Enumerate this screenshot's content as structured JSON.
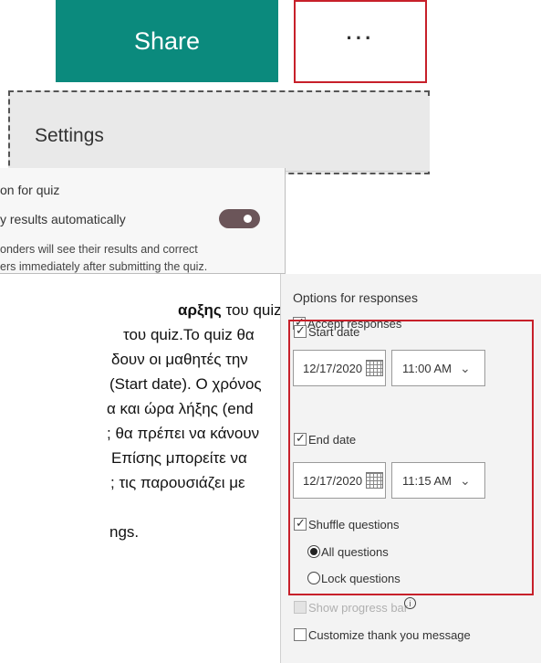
{
  "toolbar": {
    "share_label": "Share",
    "more_label": "···"
  },
  "settings": {
    "label": "Settings"
  },
  "quiz_options": {
    "title": "on for quiz",
    "toggle_label": "y results automatically",
    "description_line1": "onders will see their results and correct",
    "description_line2": "ers immediately after submitting the quiz."
  },
  "greek_text": {
    "line1_bold": "αρξης",
    "line1_rest": " του quiz καθώς",
    "line2": "του quiz.Το quiz θα",
    "line3": "δουν οι μαθητές την",
    "line4": "(Start date). Ο χρόνος",
    "line5": "α και ώρα λήξης (end",
    "line6": "; θα πρέπει να κάνουν",
    "line7": "Επίσης μπορείτε να",
    "line8": "; τις παρουσιάζει με",
    "line9": "ngs."
  },
  "options_panel": {
    "title": "Options for responses",
    "accept_responses": "Accept responses",
    "start_date_label": "Start date",
    "start_date_value": "12/17/2020",
    "start_time_value": "11:00 AM",
    "end_date_label": "End date",
    "end_date_value": "12/17/2020",
    "end_time_value": "11:15 AM",
    "shuffle_questions": "Shuffle questions",
    "all_questions": "All questions",
    "lock_questions": "Lock questions",
    "show_progress_bar": "Show progress bar",
    "customize_thank_you": "Customize thank you message"
  },
  "icons": {
    "dropdown": "chevron-down-icon",
    "calendar": "calendar-icon",
    "info": "info-icon"
  }
}
